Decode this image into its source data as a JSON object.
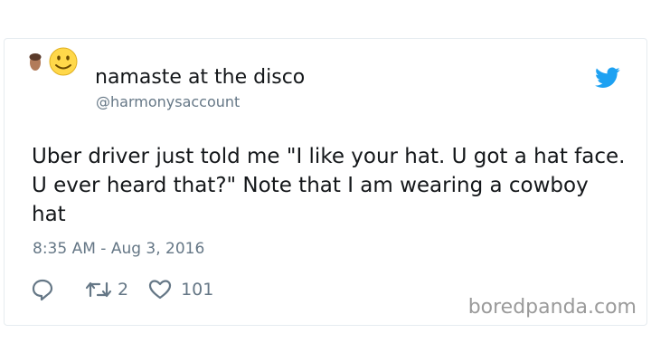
{
  "tweet": {
    "display_name": "namaste at the disco",
    "handle": "@harmonysaccount",
    "text": "Uber driver just told me \"I like your hat. U got a hat face. U ever heard that?\" Note that I am wearing a cowboy hat",
    "timestamp": "8:35 AM - Aug 3, 2016",
    "retweet_count": "2",
    "like_count": "101"
  },
  "icons": {
    "avatar": "avatar-with-smiley-emoji",
    "brand": "twitter-bird-icon",
    "reply": "reply-icon",
    "retweet": "retweet-icon",
    "like": "heart-icon"
  },
  "colors": {
    "twitter_blue": "#1da1f2",
    "secondary_text": "#657786",
    "primary_text": "#14171a"
  },
  "watermark": "boredpanda.com"
}
